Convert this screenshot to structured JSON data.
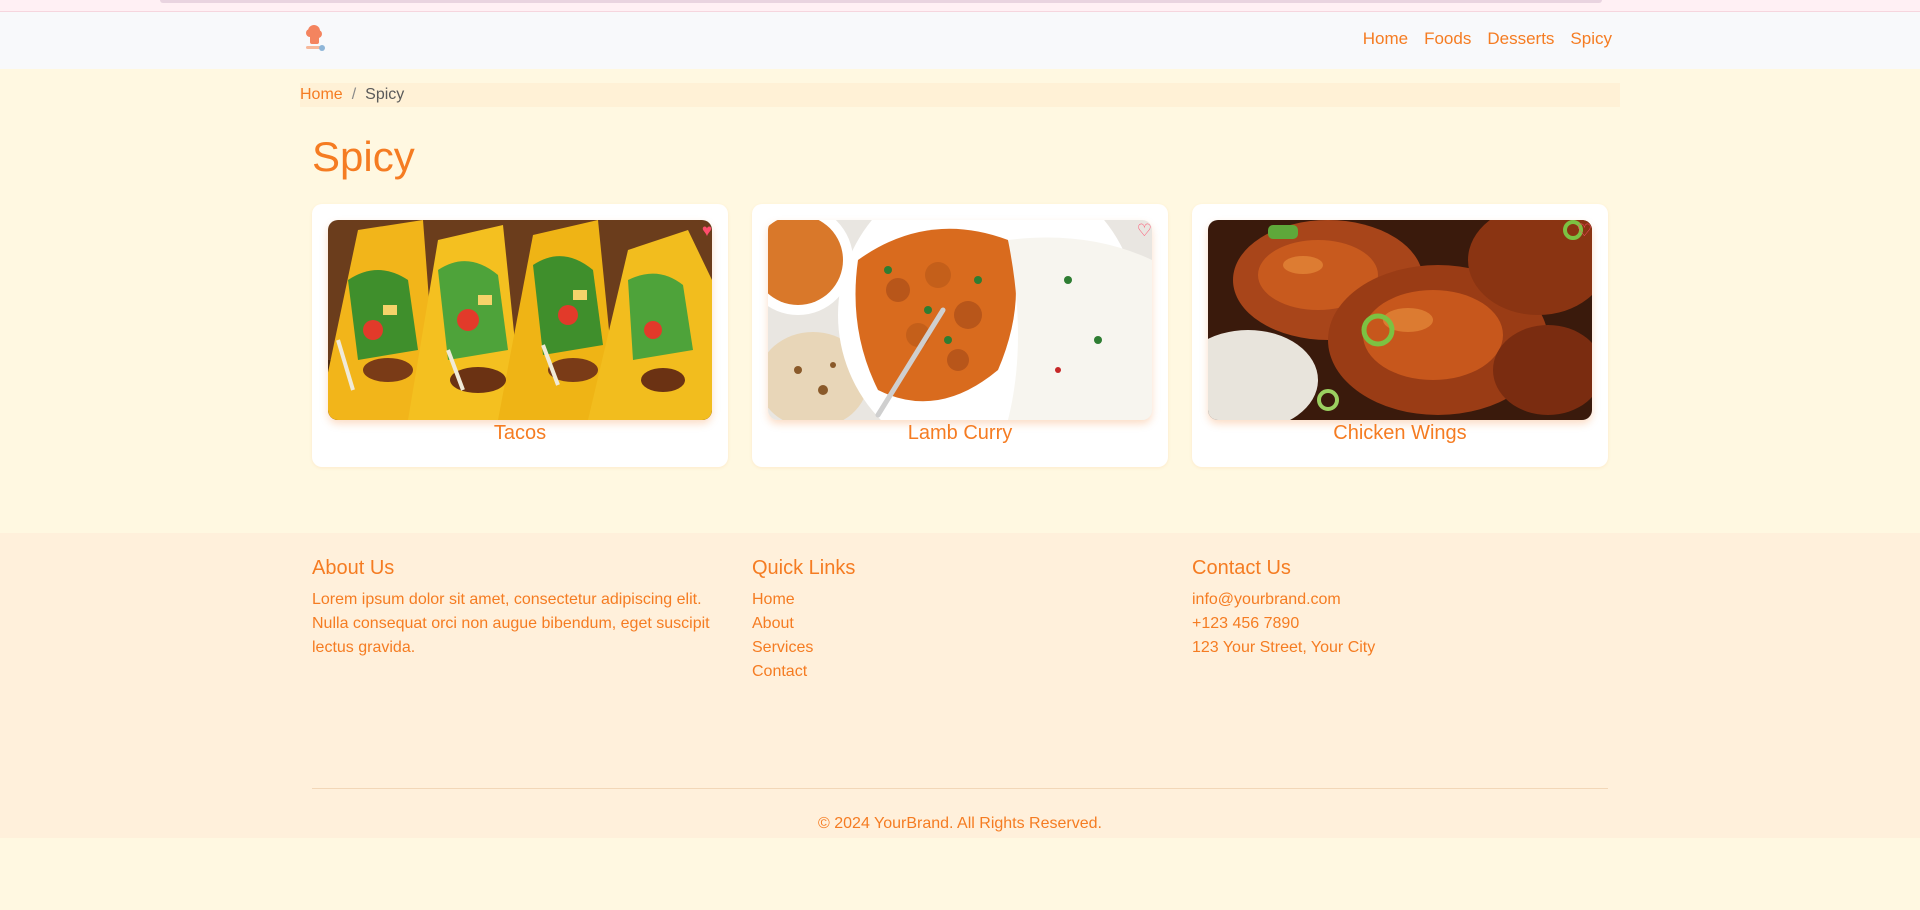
{
  "nav": {
    "logo_icon": "chef-hat-logo-icon",
    "links": [
      "Home",
      "Foods",
      "Desserts",
      "Spicy"
    ]
  },
  "breadcrumb": {
    "home": "Home",
    "separator": "/",
    "current": "Spicy"
  },
  "page": {
    "title": "Spicy"
  },
  "cards": [
    {
      "name": "Tacos",
      "favorite": true,
      "heart_icon": "heart-filled-icon"
    },
    {
      "name": "Lamb Curry",
      "favorite": false,
      "heart_icon": "heart-outline-icon"
    },
    {
      "name": "Chicken Wings",
      "favorite": false,
      "heart_icon": "heart-outline-icon"
    }
  ],
  "footer": {
    "about": {
      "heading": "About Us",
      "text": "Lorem ipsum dolor sit amet, consectetur adipiscing elit. Nulla consequat orci non augue bibendum, eget suscipit lectus gravida."
    },
    "quick_links": {
      "heading": "Quick Links",
      "items": [
        "Home",
        "About",
        "Services",
        "Contact"
      ]
    },
    "contact": {
      "heading": "Contact Us",
      "email": "info@yourbrand.com",
      "phone": "+123 456 7890",
      "address": "123 Your Street, Your City"
    },
    "copyright": "© 2024 YourBrand. All Rights Reserved."
  },
  "colors": {
    "accent": "#f57c22",
    "background": "#fff8e1",
    "footer_bg": "#fff0db",
    "heart_filled": "#ff4d6d"
  }
}
